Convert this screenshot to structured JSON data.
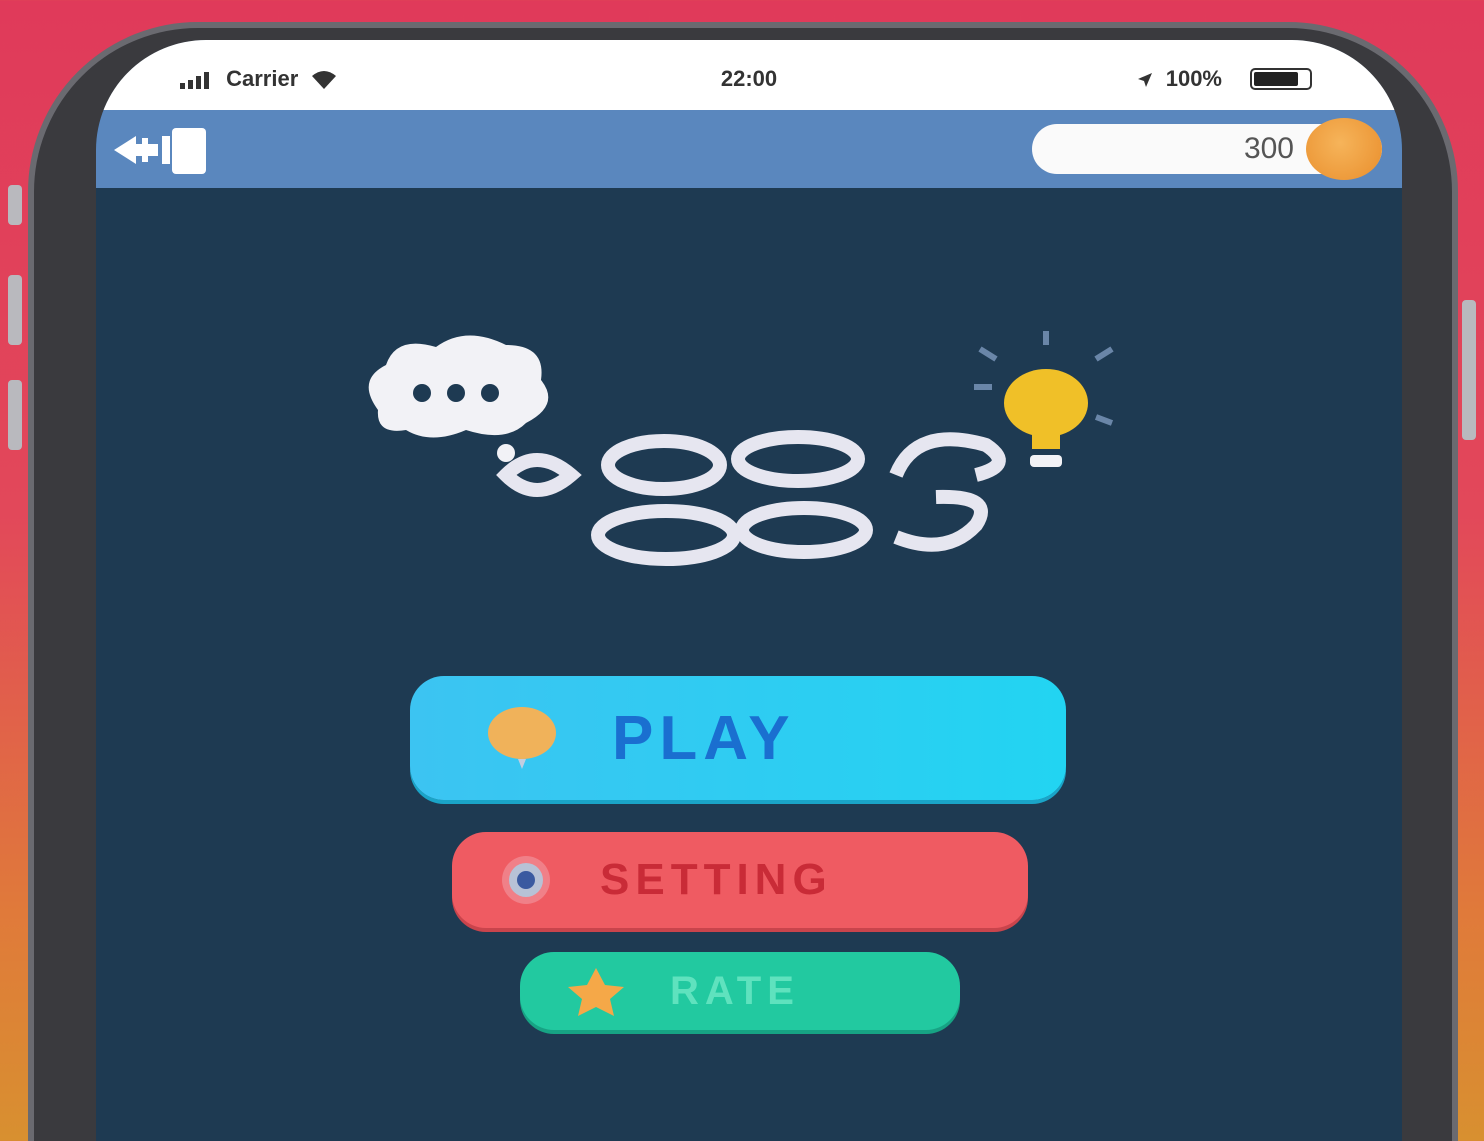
{
  "status_bar": {
    "carrier": "Carrier",
    "time": "22:00",
    "battery_percent": "100%",
    "icons": [
      "signal-icon",
      "wifi-icon",
      "location-icon",
      "battery-icon"
    ]
  },
  "top_bar": {
    "exit_icon": "exit-icon",
    "coins": "300",
    "coin_icon": "coin-icon"
  },
  "logo": {
    "icons": [
      "thought-bubble-icon",
      "lightbulb-icon"
    ]
  },
  "menu": {
    "play": {
      "label": "PLAY",
      "icon": "balloon-icon"
    },
    "setting": {
      "label": "SETTING",
      "icon": "gear-icon"
    },
    "rate": {
      "label": "RATE",
      "icon": "star-icon"
    }
  },
  "colors": {
    "background_top": "#e03a5a",
    "background_bottom": "#d89030",
    "screen": "#1e3a52",
    "top_bar": "#5a87be",
    "play": "#2ccaf2",
    "setting": "#ef5b62",
    "rate": "#22c9a0",
    "coin": "#f0a040"
  }
}
